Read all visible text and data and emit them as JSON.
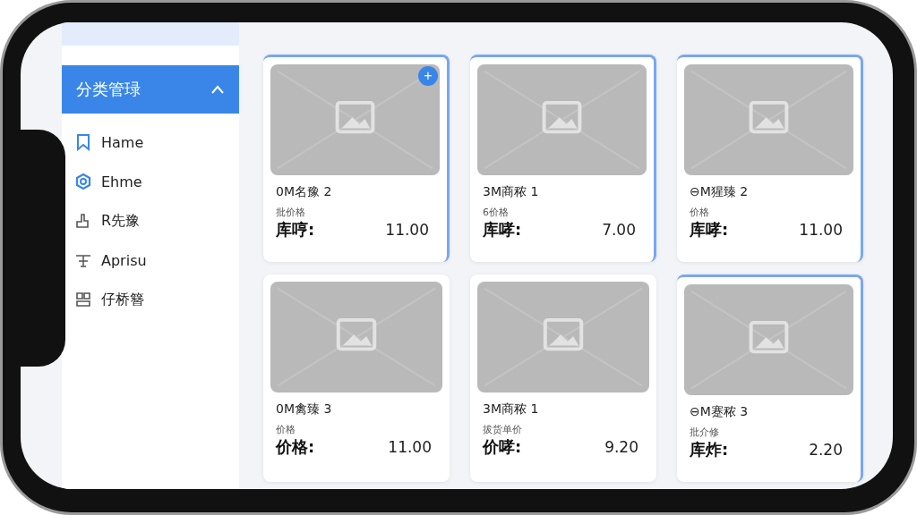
{
  "sidebar": {
    "header": {
      "label": "分类管琭",
      "expanded": true
    },
    "items": [
      {
        "label": "Hame",
        "kind": "bookmark"
      },
      {
        "label": "Ehme",
        "kind": "gear"
      },
      {
        "label": "R先豫",
        "kind": "hand"
      },
      {
        "label": "Aprisu",
        "kind": "scale"
      },
      {
        "label": "仔桥簪",
        "kind": "layout"
      }
    ]
  },
  "cards": [
    {
      "name": "0M名豫 2",
      "price_label": "批价格",
      "stock_label": "库哼:",
      "value": "11.00",
      "selected": true,
      "add_button": "+"
    },
    {
      "name": "3M商秾 1",
      "price_label": "6价格",
      "stock_label": "库哮:",
      "value": "7.00",
      "selected": true
    },
    {
      "name": "⊖M猩臻 2",
      "price_label": "价格",
      "stock_label": "库哮:",
      "value": "11.00",
      "selected": true
    },
    {
      "name": "0M禽臻 3",
      "price_label": "价格",
      "stock_label": "价格:",
      "value": "11.00",
      "selected": false
    },
    {
      "name": "3M商秾 1",
      "price_label": "拔货单价",
      "stock_label": "价哮:",
      "value": "9.20",
      "selected": false
    },
    {
      "name": "⊖M蹇秾 3",
      "price_label": "批介修",
      "stock_label": "库炸:",
      "value": "2.20",
      "selected": true
    }
  ]
}
